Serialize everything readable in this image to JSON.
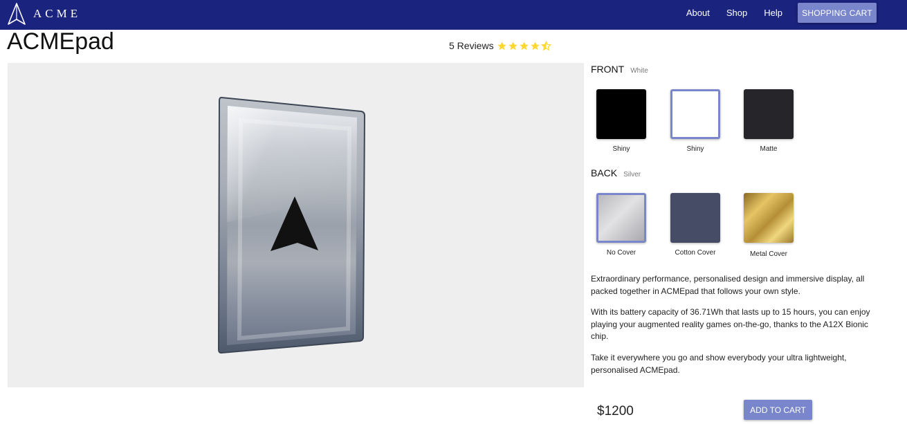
{
  "header": {
    "logo_text": "ACME",
    "nav": [
      "About",
      "Shop",
      "Help"
    ],
    "cart_label": "SHOPPING CART"
  },
  "product": {
    "title": "ACMEpad",
    "reviews_label": "5 Reviews",
    "rating": 4.5,
    "rating_max": 5,
    "price": "$1200",
    "add_to_cart_label": "ADD TO CART"
  },
  "front": {
    "heading": "FRONT",
    "selected": "White",
    "options": [
      {
        "label": "Shiny",
        "color": "#000000",
        "selected": false
      },
      {
        "label": "Shiny",
        "color": "#ffffff",
        "selected": true
      },
      {
        "label": "Matte",
        "color": "#25252a",
        "selected": false
      }
    ]
  },
  "back": {
    "heading": "BACK",
    "selected": "Silver",
    "options": [
      {
        "label": "No Cover",
        "color": "#c8c8cc",
        "selected": true
      },
      {
        "label": "Cotton Cover",
        "color": "#474c66",
        "selected": false
      },
      {
        "label": "Metal Cover",
        "color": "#c9a244",
        "selected": false
      }
    ]
  },
  "description": [
    "Extraordinary performance, personalised design and immersive display, all packed together in ACMEpad that follows your own style.",
    "With its battery capacity of 36.71Wh that lasts up to 15 hours, you can enjoy playing your augmented reality games on-the-go, thanks to the A12X Bionic chip.",
    "Take it everywhere you go and show everybody your ultra lightweight, personalised ACMEpad."
  ],
  "colors": {
    "navbar": "#1a237e",
    "accent": "#7986cb",
    "star": "#fdd835"
  }
}
